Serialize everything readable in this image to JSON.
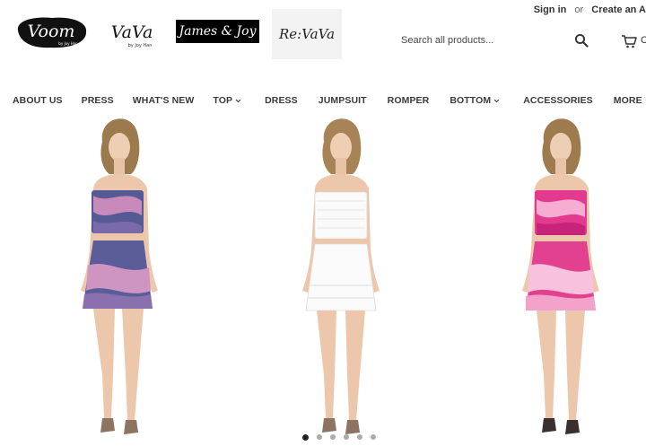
{
  "account": {
    "sign_in": "Sign in",
    "separator": "or",
    "create_account": "Create an A"
  },
  "logos": {
    "voom": "Voom",
    "voom_sub": "by Joy Han",
    "vava": "VaVa",
    "vava_sub": "by Joy Han",
    "james_joy": "James & Joy",
    "revava": "Re:VaVa"
  },
  "search": {
    "placeholder": "Search all products..."
  },
  "cart": {
    "label": "C"
  },
  "nav": {
    "items": [
      {
        "label": "ABOUT US",
        "dropdown": false
      },
      {
        "label": "PRESS",
        "dropdown": false
      },
      {
        "label": "WHAT'S NEW",
        "dropdown": false
      },
      {
        "label": "TOP",
        "dropdown": true
      },
      {
        "label": "DRESS",
        "dropdown": false
      },
      {
        "label": "JUMPSUIT",
        "dropdown": false
      },
      {
        "label": "ROMPER",
        "dropdown": false
      },
      {
        "label": "BOTTOM",
        "dropdown": true
      },
      {
        "label": "ACCESSORIES",
        "dropdown": false
      },
      {
        "label": "MORE",
        "dropdown": true
      }
    ]
  },
  "slideshow": {
    "models": [
      {
        "outfit": "tie-dye navy/pink smocked tube top and tiered skirt",
        "colors": [
          "#4a4f86",
          "#c58ab6",
          "#8a6aa8"
        ]
      },
      {
        "outfit": "white smocked tube top and tiered skirt",
        "colors": [
          "#fafafa",
          "#eeeeee",
          "#dcdcdc"
        ]
      },
      {
        "outfit": "tie-dye pink smocked tube top and tiered skirt",
        "colors": [
          "#e0388d",
          "#f4a9cf",
          "#c52273"
        ]
      }
    ],
    "slide_count": 6,
    "active_slide": 1
  },
  "colors": {
    "text": "#333333",
    "dot_active": "#222222",
    "dot_inactive": "#aaaaaa"
  }
}
